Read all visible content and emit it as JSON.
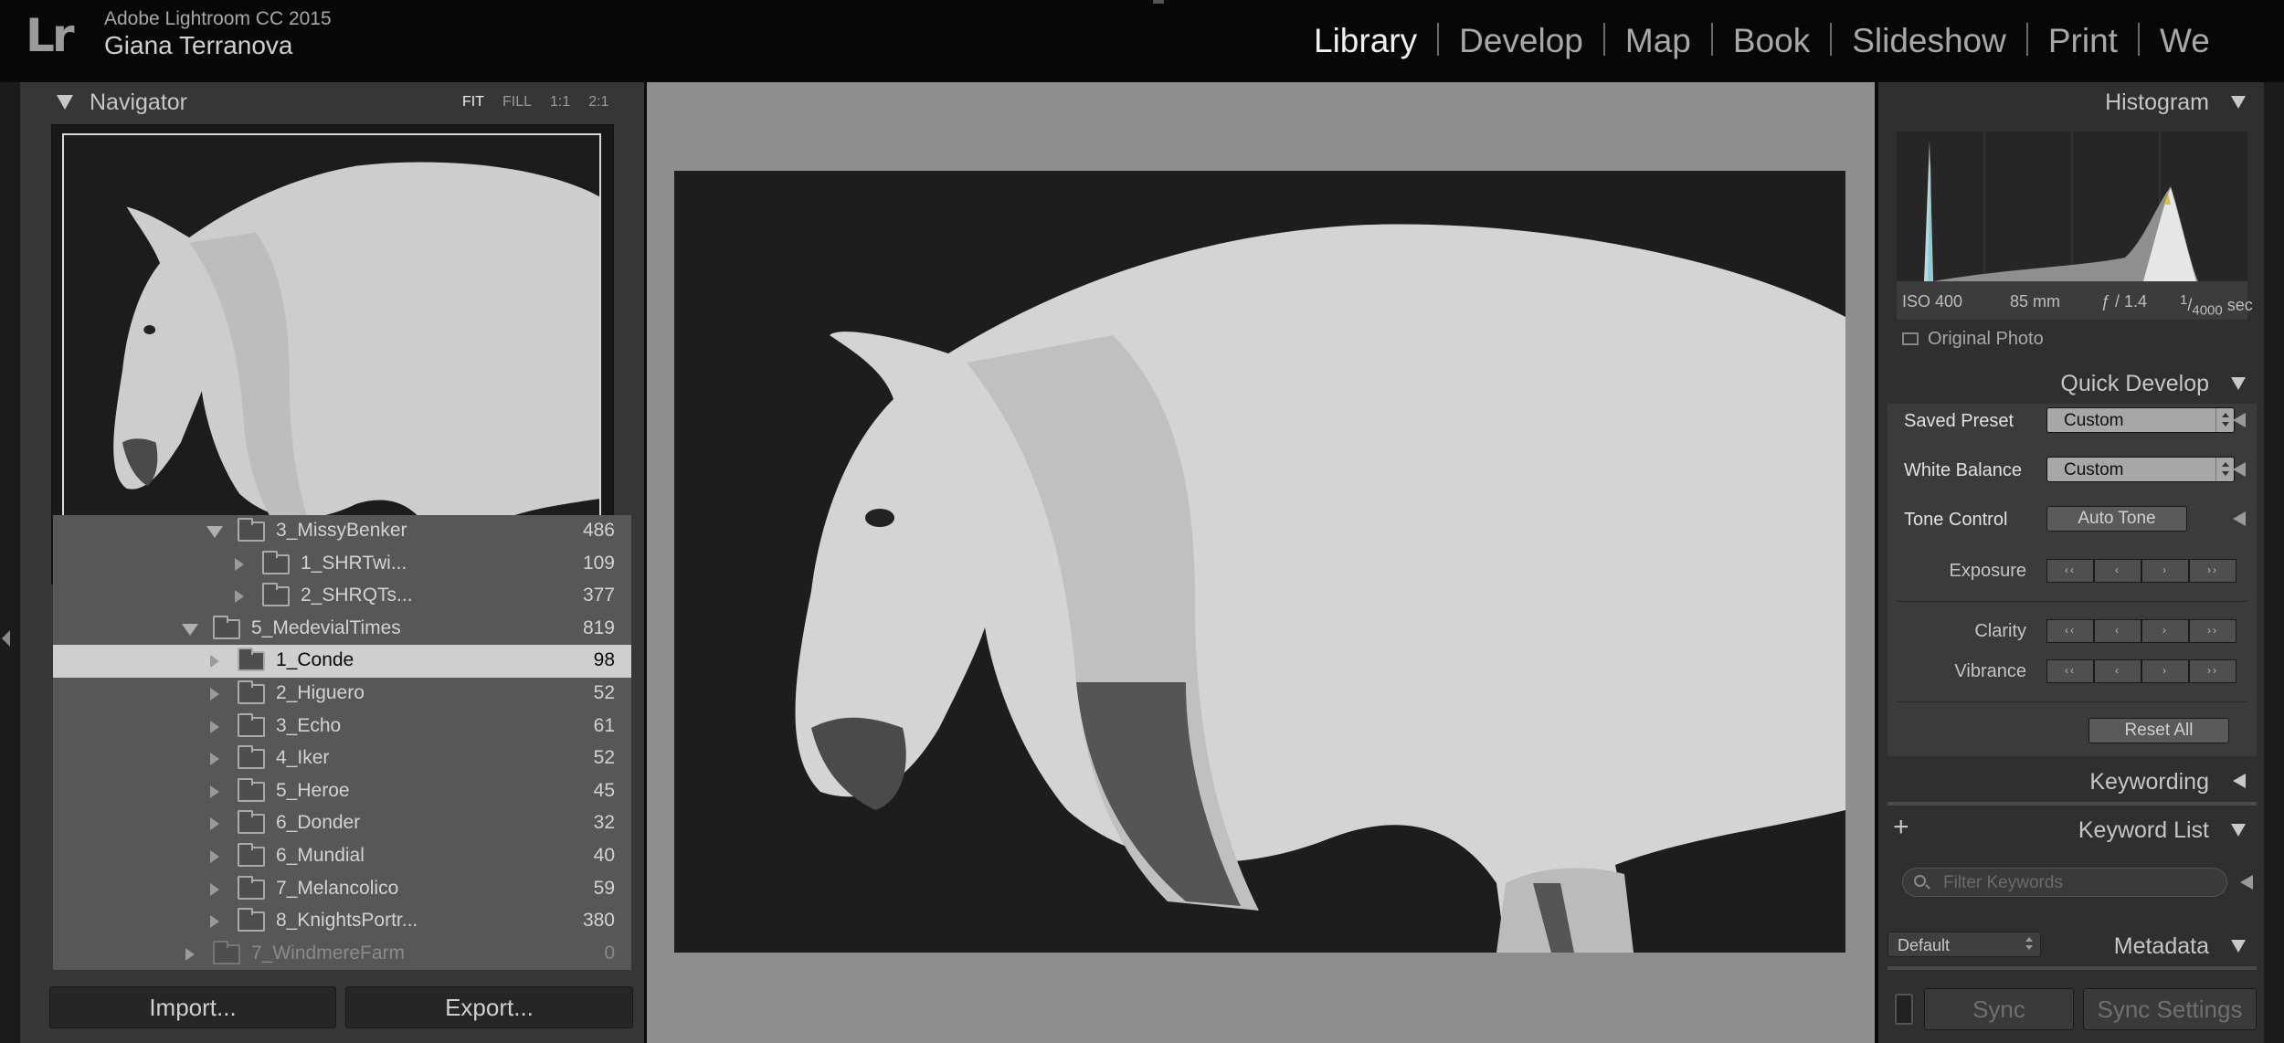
{
  "app": {
    "version": "Adobe Lightroom CC 2015",
    "user": "Giana Terranova",
    "modules": [
      "Library",
      "Develop",
      "Map",
      "Book",
      "Slideshow",
      "Print",
      "We"
    ],
    "active_module": "Library"
  },
  "navigator": {
    "title": "Navigator",
    "zoom_options": [
      "FIT",
      "FILL",
      "1:1",
      "2:1"
    ],
    "active_zoom": "FIT"
  },
  "folders": [
    {
      "name": "3_MissyBenker",
      "count": "486",
      "level": 1,
      "expanded": true,
      "selected": false,
      "dim": false
    },
    {
      "name": "1_SHRTwi...",
      "count": "109",
      "level": 2,
      "expanded": false,
      "selected": false,
      "dim": false
    },
    {
      "name": "2_SHRQTs...",
      "count": "377",
      "level": 2,
      "expanded": false,
      "selected": false,
      "dim": false
    },
    {
      "name": "5_MedevialTimes",
      "count": "819",
      "level": 0,
      "expanded": true,
      "selected": false,
      "dim": false
    },
    {
      "name": "1_Conde",
      "count": "98",
      "level": 1,
      "expanded": false,
      "selected": true,
      "dim": false
    },
    {
      "name": "2_Higuero",
      "count": "52",
      "level": 1,
      "expanded": false,
      "selected": false,
      "dim": false
    },
    {
      "name": "3_Echo",
      "count": "61",
      "level": 1,
      "expanded": false,
      "selected": false,
      "dim": false
    },
    {
      "name": "4_Iker",
      "count": "52",
      "level": 1,
      "expanded": false,
      "selected": false,
      "dim": false
    },
    {
      "name": "5_Heroe",
      "count": "45",
      "level": 1,
      "expanded": false,
      "selected": false,
      "dim": false
    },
    {
      "name": "6_Donder",
      "count": "32",
      "level": 1,
      "expanded": false,
      "selected": false,
      "dim": false
    },
    {
      "name": "6_Mundial",
      "count": "40",
      "level": 1,
      "expanded": false,
      "selected": false,
      "dim": false
    },
    {
      "name": "7_Melancolico",
      "count": "59",
      "level": 1,
      "expanded": false,
      "selected": false,
      "dim": false
    },
    {
      "name": "8_KnightsPortr...",
      "count": "380",
      "level": 1,
      "expanded": false,
      "selected": false,
      "dim": false
    },
    {
      "name": "7_WindmereFarm",
      "count": "0",
      "level": 0,
      "expanded": false,
      "selected": false,
      "dim": true
    }
  ],
  "buttons": {
    "import": "Import...",
    "export": "Export..."
  },
  "histogram": {
    "title": "Histogram",
    "iso": "ISO 400",
    "focal": "85 mm",
    "aperture": "ƒ / 1.4",
    "shutter_num": "1",
    "shutter_den": "4000",
    "shutter_unit": "sec",
    "original_photo": "Original Photo"
  },
  "quick_develop": {
    "title": "Quick Develop",
    "saved_preset_label": "Saved Preset",
    "saved_preset_value": "Custom",
    "white_balance_label": "White Balance",
    "white_balance_value": "Custom",
    "tone_control_label": "Tone Control",
    "auto_tone": "Auto Tone",
    "exposure_label": "Exposure",
    "clarity_label": "Clarity",
    "vibrance_label": "Vibrance",
    "reset_all": "Reset All"
  },
  "keywording": {
    "title": "Keywording"
  },
  "keyword_list": {
    "title": "Keyword List",
    "add_symbol": "+",
    "filter_placeholder": "Filter Keywords"
  },
  "metadata": {
    "title": "Metadata",
    "preset": "Default"
  },
  "sync": {
    "sync_label": "Sync",
    "sync_settings_label": "Sync Settings"
  },
  "icons": {
    "logo": "Lr"
  },
  "colors": {
    "background": "#0b0b0b",
    "panel": "#363636",
    "folder_list": "#575757",
    "selected_row": "#cfcfcf",
    "center_bg": "#8e8e8e",
    "photo_bg": "#1d1d1d"
  }
}
